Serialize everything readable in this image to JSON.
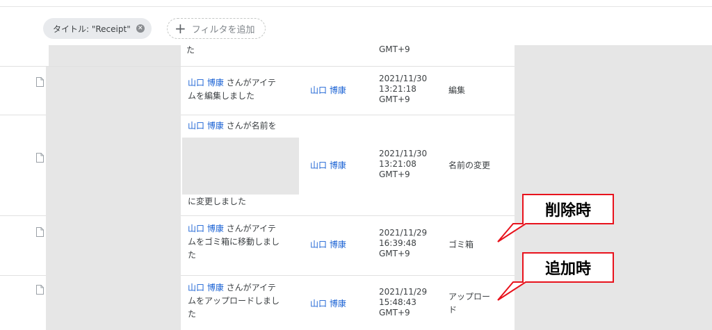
{
  "filter": {
    "chip_label": "タイトル: \"Receipt\"",
    "add_filter_label": "フィルタを追加"
  },
  "partial_row": {
    "desc_tail": "た",
    "date_tail": "GMT+9"
  },
  "rows": [
    {
      "user": "山口 博康",
      "desc_after": "さんがアイテ",
      "desc_line2": "ムを編集しました",
      "desc_line3": "",
      "date1": "2021/11/30",
      "date2": "13:21:18",
      "date3": "GMT+9",
      "action": "編集"
    },
    {
      "user": "山口 博康",
      "desc_after": "さんが名前を",
      "desc_line2": "に変更しました",
      "desc_line3": "",
      "date1": "2021/11/30",
      "date2": "13:21:08",
      "date3": "GMT+9",
      "action": "名前の変更"
    },
    {
      "user": "山口 博康",
      "desc_after": "さんがアイテ",
      "desc_line2": "ムをゴミ箱に移動しまし",
      "desc_line3": "た",
      "date1": "2021/11/29",
      "date2": "16:39:48",
      "date3": "GMT+9",
      "action": "ゴミ箱"
    },
    {
      "user": "山口 博康",
      "desc_after": "さんがアイテ",
      "desc_line2": "ムをアップロードしまし",
      "desc_line3": "た",
      "date1": "2021/11/29",
      "date2": "15:48:43",
      "date3": "GMT+9",
      "action": "アップロー",
      "action2": "ド"
    }
  ],
  "callouts": {
    "delete_label": "削除時",
    "add_label": "追加時",
    "border_color": "#e8121c"
  },
  "colors": {
    "link": "#1a62d4",
    "redaction": "#e6e6e6"
  }
}
